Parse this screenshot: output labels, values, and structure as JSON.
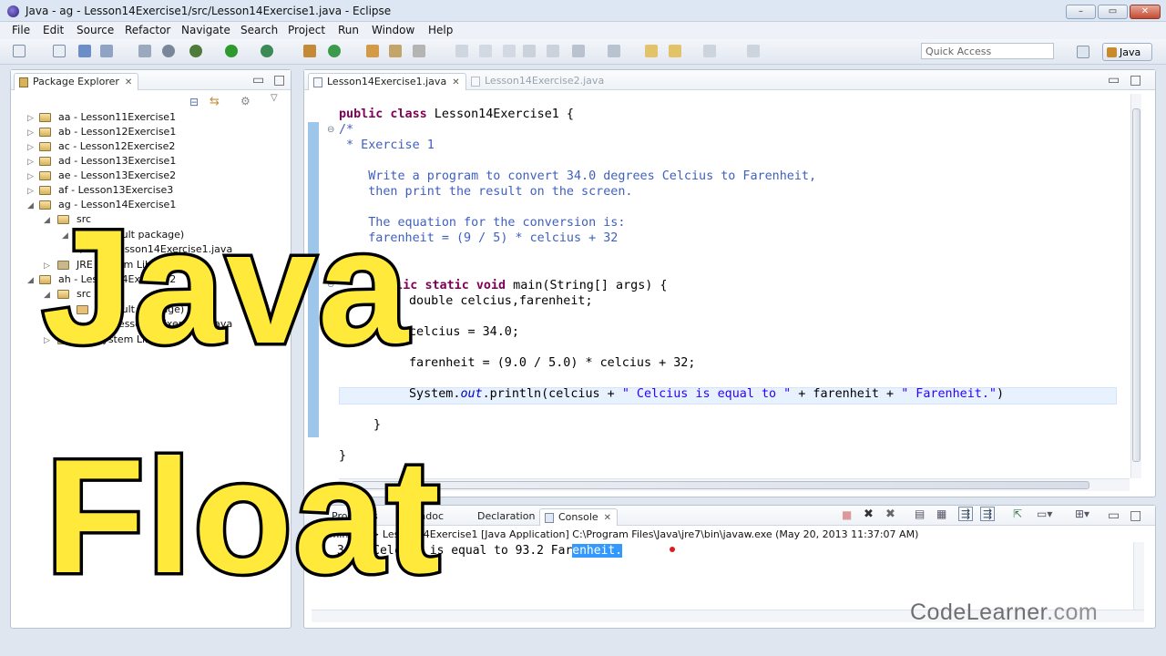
{
  "window": {
    "title": "Java - ag - Lesson14Exercise1/src/Lesson14Exercise1.java - Eclipse",
    "buttons": [
      "–",
      "▭",
      "✕"
    ]
  },
  "menu": [
    "File",
    "Edit",
    "Source",
    "Refactor",
    "Navigate",
    "Search",
    "Project",
    "Run",
    "Window",
    "Help"
  ],
  "toolbar": {
    "quick_access_placeholder": "Quick Access",
    "perspective_label": "Java"
  },
  "package_explorer": {
    "title": "Package Explorer",
    "items": [
      {
        "label": "aa - Lesson11Exercise1"
      },
      {
        "label": "ab - Lesson12Exercise1"
      },
      {
        "label": "ac - Lesson12Exercise2"
      },
      {
        "label": "ad - Lesson13Exercise1"
      },
      {
        "label": "ae - Lesson13Exercise2"
      },
      {
        "label": "af - Lesson13Exercise3"
      },
      {
        "label": "ag - Lesson14Exercise1"
      },
      {
        "label": "src"
      },
      {
        "label": "(default package)"
      },
      {
        "label": "Lesson14Exercise1.java"
      },
      {
        "label": "JRE System Library"
      },
      {
        "label": "ah - Lesson14Exercise2"
      },
      {
        "label": "src"
      },
      {
        "label": "(default package)"
      },
      {
        "label": "Lesson14Exercise2.java"
      },
      {
        "label": "JRE System Library"
      }
    ]
  },
  "editor": {
    "tabs": [
      {
        "label": "Lesson14Exercise1.java",
        "active": true
      },
      {
        "label": "Lesson14Exercise2.java",
        "active": false
      }
    ],
    "code": {
      "l1_kw": "public class",
      "l1_rest": " Lesson14Exercise1 {",
      "c1": "/*",
      "c2": " * Exercise 1",
      "c3": "    Write a program to convert 34.0 degrees Celcius to Farenheit,",
      "c4": "    then print the result on the screen.",
      "c5": "    The equation for the conversion is:",
      "c6": "    farenheit = (9 / 5) * celcius + 32",
      "m_kw1": "public",
      "m_kw2": "void",
      "m_rest": " main(String[] args) {",
      "decl": "double celcius,farenheit;",
      "assign": "celcius = 34.0;",
      "calc": "farenheit = (9.0 / 5.0) * celcius + 32;",
      "println_a": "System.",
      "println_out": "out",
      "println_b": ".println(celcius + ",
      "println_s1": "\" Celcius is equal to \"",
      "println_c": " + farenheit + ",
      "println_s2": "\" Farenheit.\"",
      "println_d": ")",
      "close_inner": "}",
      "close_outer": "}"
    }
  },
  "bottom_panel": {
    "tabs": [
      "Problems",
      "Javadoc",
      "Declaration",
      "Console"
    ],
    "console_header": "<terminated> Lesson14Exercise1 [Java Application] C:\\Program Files\\Java\\jre7\\bin\\javaw.exe (May 20, 2013 11:37:07 AM)",
    "output_pre": "34.0 Celcius is equal to 93.2 Far",
    "output_sel": "enheit."
  },
  "overlay": {
    "line1": "Java",
    "line2": "Float"
  },
  "watermark": {
    "brand": "CodeLearner",
    "suffix": ".com"
  },
  "colors": {
    "overlay_fill": "#ffe93a",
    "keyword": "#7f0055",
    "comment": "#3f5fbf",
    "string": "#2a00ff"
  }
}
